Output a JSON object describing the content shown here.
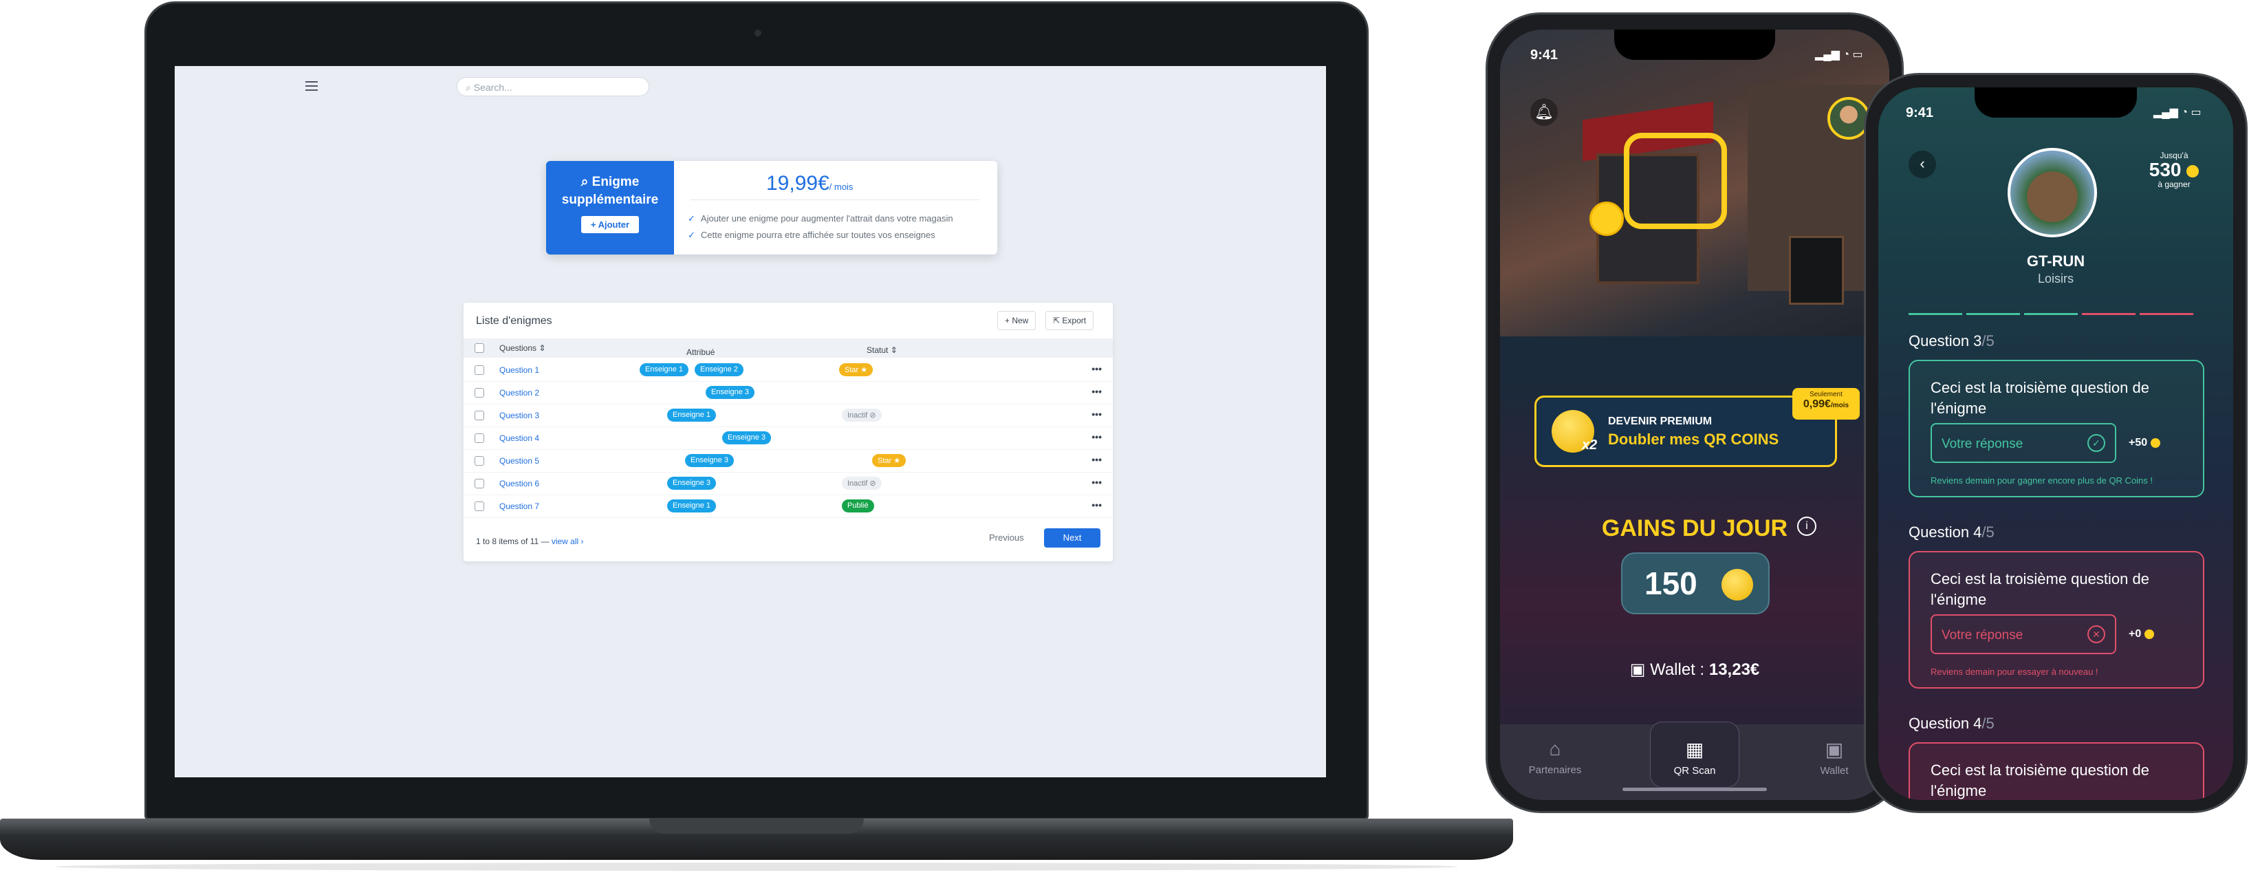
{
  "laptop": {
    "search_placeholder": "Search...",
    "enigme": {
      "title": "Enigme supplémentaire",
      "add_button": "+ Ajouter",
      "price": "19,99€",
      "per": "/ mois",
      "features": [
        "Ajouter une enigme pour augmenter l'attrait dans votre magasin",
        "Cette enigme pourra etre affichée sur toutes vos enseignes"
      ]
    },
    "table": {
      "title": "Liste d'enigmes",
      "new_label": "+ New",
      "export_label": "Export",
      "col_questions": "Questions",
      "col_attribue": "Attribué",
      "col_statut": "Statut",
      "rows": [
        {
          "q": "Question 1",
          "tags": [
            "Enseigne 1",
            "Enseigne 2"
          ],
          "statut": "Star ★"
        },
        {
          "q": "Question 2",
          "tags": [
            "Enseigne 3"
          ],
          "statut": ""
        },
        {
          "q": "Question 3",
          "tags": [
            "Enseigne 1"
          ],
          "statut": "Inactif ⊘"
        },
        {
          "q": "Question 4",
          "tags": [
            "Enseigne 3"
          ],
          "statut": ""
        },
        {
          "q": "Question 5",
          "tags": [
            "Enseigne 3"
          ],
          "statut": "Star ★"
        },
        {
          "q": "Question 6",
          "tags": [
            "Enseigne 3"
          ],
          "statut": "Inactif ⊘"
        },
        {
          "q": "Question 7",
          "tags": [
            "Enseigne 1"
          ],
          "statut": "Publié"
        }
      ],
      "footer": "1 to 8 items of 11",
      "view_all": "view all ›",
      "previous": "Previous",
      "next": "Next"
    }
  },
  "phone1": {
    "time": "9:41",
    "premium_line1": "DEVENIR PREMIUM",
    "premium_line2": "Doubler mes QR COINS",
    "badge_line1": "Seulement",
    "badge_price": "0,99€",
    "badge_per": "/mois",
    "coin_label": "x2",
    "gains_title": "GAINS DU JOUR",
    "gains_value": "150",
    "wallet_label": "Wallet :",
    "wallet_value": "13,23€",
    "tabs": [
      "Partenaires",
      "QR Scan",
      "Wallet"
    ]
  },
  "phone2": {
    "time": "9:41",
    "jusqua": "Jusqu'à",
    "max_points": "530",
    "a_gagner": "à gagner",
    "name": "GT-RUN",
    "category": "Loisirs",
    "progress_colors": [
      "#44c59f",
      "#44c59f",
      "#44c59f",
      "#e0506a",
      "#e0506a"
    ],
    "questions": [
      {
        "label": "Question 3",
        "total": "/5",
        "text": "Ceci est la troisième question de l'énigme",
        "answer": "Votre réponse",
        "points": "+50",
        "message": "Reviens demain pour gagner encore plus de QR Coins !"
      },
      {
        "label": "Question 4",
        "total": "/5",
        "text": "Ceci est la troisième question de l'énigme",
        "answer": "Votre réponse",
        "points": "+0",
        "message": "Reviens demain pour essayer à nouveau !"
      },
      {
        "label": "Question 4",
        "total": "/5",
        "text": "Ceci est la troisième question de l'énigme"
      }
    ]
  },
  "colors": {
    "accent": "#1f6fe0",
    "gold": "#ffcf1f",
    "success": "#44c59f",
    "error": "#e0506a"
  }
}
